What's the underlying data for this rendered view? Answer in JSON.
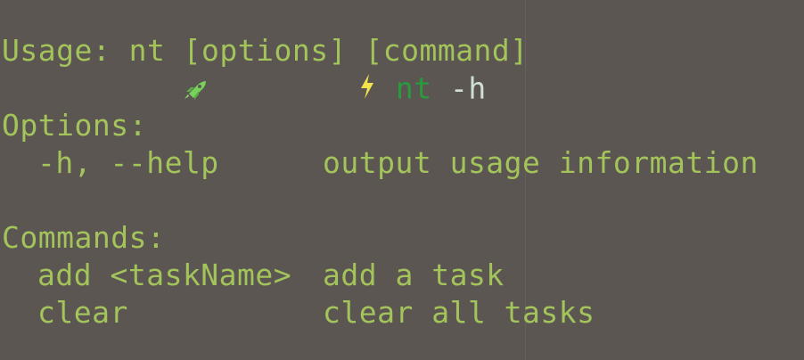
{
  "terminal": {
    "prompt": {
      "command": "nt",
      "argument": "-h"
    },
    "usage": "Usage: nt [options] [command]",
    "options_heading": "Options:",
    "options": [
      {
        "flag": "-h, --help",
        "description": "output usage information"
      }
    ],
    "commands_heading": "Commands:",
    "commands": [
      {
        "name": "add <taskName>",
        "description": "add a task"
      },
      {
        "name": "clear",
        "description": "clear all tasks"
      }
    ]
  },
  "colors": {
    "background": "#5b5651",
    "text": "#a3c35b",
    "command": "#2a9a3e",
    "rocket": "#6fcf5a",
    "bolt": "#f2e44a"
  },
  "icons": {
    "rocket": "rocket-icon",
    "bolt": "lightning-bolt-icon"
  }
}
